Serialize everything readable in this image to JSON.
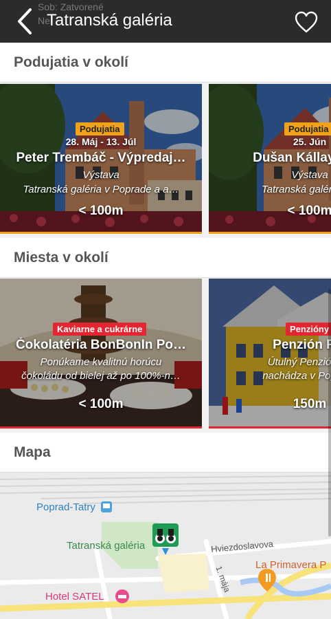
{
  "header": {
    "title": "Tatranská galéria",
    "ghost_line1": "Sob: Zatvorené",
    "ghost_line2": "Ne"
  },
  "events": {
    "heading": "Podujatia v okolí",
    "cards": [
      {
        "badge": "Podujatia",
        "date": "28. Máj - 13. Júl",
        "name": "Peter Trembáč - Výpredaj…",
        "type": "Výstava",
        "place": "Tatranská galéria v Poprade a a…",
        "distance": "< 100m"
      },
      {
        "badge": "Podujatia",
        "date": "25. Jún",
        "name": "Dušan Kállay Kam",
        "type": "Výstava",
        "place": "Tatranská galéria v P",
        "distance": "< 100m"
      }
    ]
  },
  "places": {
    "heading": "Miesta v okolí",
    "cards": [
      {
        "badge": "Kaviarne a cukrárne",
        "name": "Čokolatéria BonBonIn Po…",
        "desc1": "Ponúkame kvalitnú horúcu",
        "desc2": "čokoládu od bielej až po 100%-n…",
        "distance": "< 100m"
      },
      {
        "badge": "Penzióny",
        "name": "Penzión Far",
        "desc1": "Útulný Penzión Fa",
        "desc2": "nachádza v Poprade",
        "distance": "150m"
      }
    ]
  },
  "map": {
    "heading": "Mapa",
    "labels": {
      "station": "Poprad-Tatry",
      "gallery": "Tatranská galéria",
      "street1": "Hviezdoslavova",
      "street2": "1. mája",
      "primavera": "La Primavera P",
      "hotel": "Hotel SATEL"
    }
  },
  "colors": {
    "header_bg": "#2b2b2b",
    "event_accent": "#f0a21a",
    "place_accent": "#e52531"
  },
  "icons": [
    "back-arrow-icon",
    "map-pin-icon",
    "heart-icon",
    "binoculars-pin-icon",
    "train-icon",
    "restaurant-icon",
    "hotel-icon"
  ]
}
